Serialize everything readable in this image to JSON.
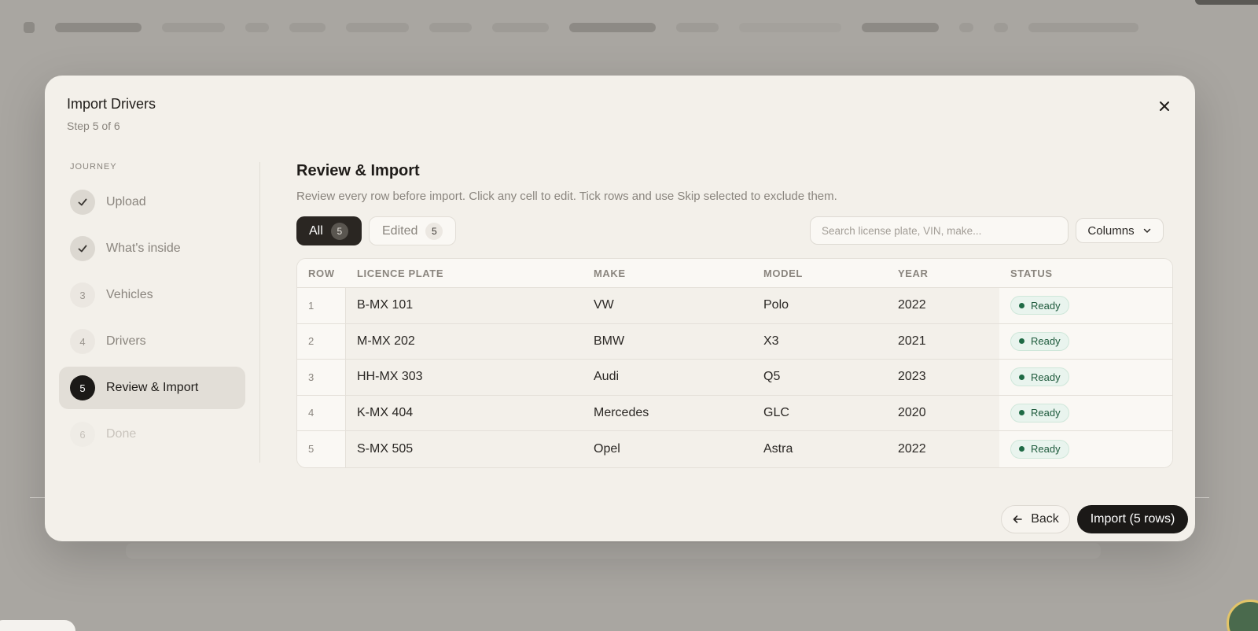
{
  "modal": {
    "title": "Import Drivers",
    "subtitle": "Step 5 of 6"
  },
  "sidebar": {
    "heading": "JOURNEY",
    "steps": [
      {
        "number": "1",
        "label": "Upload",
        "state": "done"
      },
      {
        "number": "2",
        "label": "What's inside",
        "state": "done"
      },
      {
        "number": "3",
        "label": "Vehicles",
        "state": "pending"
      },
      {
        "number": "4",
        "label": "Drivers",
        "state": "pending"
      },
      {
        "number": "5",
        "label": "Review & Import",
        "state": "current"
      },
      {
        "number": "6",
        "label": "Done",
        "state": "future"
      }
    ]
  },
  "main": {
    "title": "Review & Import",
    "description": "Review every row before import. Click any cell to edit. Tick rows and use Skip selected to exclude them.",
    "tabs": [
      {
        "label": "All",
        "count": "5"
      },
      {
        "label": "Edited",
        "count": "5"
      }
    ],
    "search_placeholder": "Search license plate, VIN, make...",
    "columns_label": "Columns"
  },
  "table": {
    "headers": [
      "ROW",
      "LICENCE PLATE",
      "MAKE",
      "MODEL",
      "YEAR",
      "STATUS"
    ],
    "rows": [
      {
        "row": "1",
        "plate": "B-MX 101",
        "make": "VW",
        "model": "Polo",
        "year": "2022",
        "status": "Ready"
      },
      {
        "row": "2",
        "plate": "M-MX 202",
        "make": "BMW",
        "model": "X3",
        "year": "2021",
        "status": "Ready"
      },
      {
        "row": "3",
        "plate": "HH-MX 303",
        "make": "Audi",
        "model": "Q5",
        "year": "2023",
        "status": "Ready"
      },
      {
        "row": "4",
        "plate": "K-MX 404",
        "make": "Mercedes",
        "model": "GLC",
        "year": "2020",
        "status": "Ready"
      },
      {
        "row": "5",
        "plate": "S-MX 505",
        "make": "Opel",
        "model": "Astra",
        "year": "2022",
        "status": "Ready"
      }
    ]
  },
  "footer": {
    "back_label": "Back",
    "import_label": "Import (5 rows)"
  },
  "colors": {
    "accent_dark": "#1b1917",
    "status_ready": "#1f6a45",
    "modal_bg": "#f3f0ea"
  },
  "icons": {
    "close": "close-icon",
    "check": "check-icon",
    "chevron": "chevron-down-icon",
    "back": "arrow-left-icon"
  }
}
